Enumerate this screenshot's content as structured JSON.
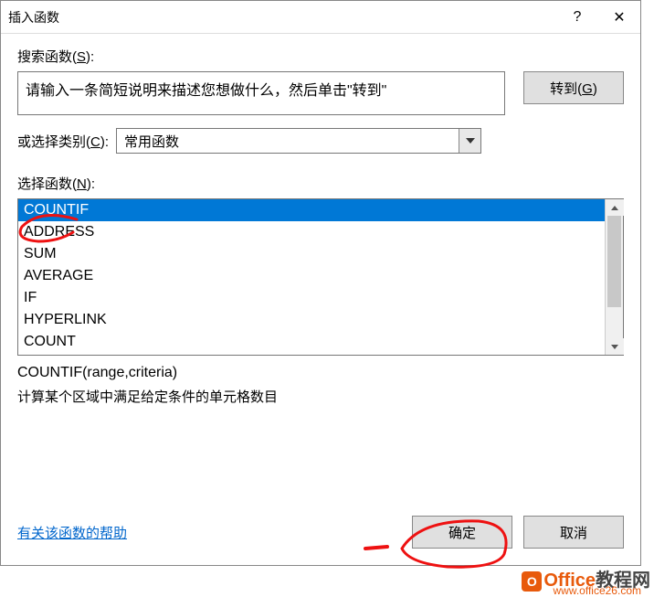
{
  "title": "插入函数",
  "help_char": "?",
  "close_char": "✕",
  "search_label_pre": "搜索函数(",
  "search_label_key": "S",
  "search_label_post": "):",
  "search_text": "请输入一条简短说明来描述您想做什么，然后单击\"转到\"",
  "go_label_pre": "转到(",
  "go_label_key": "G",
  "go_label_post": ")",
  "category_label_pre": "或选择类别(",
  "category_label_key": "C",
  "category_label_post": "):",
  "category_value": "常用函数",
  "select_label_pre": "选择函数(",
  "select_label_key": "N",
  "select_label_post": "):",
  "functions": [
    "COUNTIF",
    "ADDRESS",
    "SUM",
    "AVERAGE",
    "IF",
    "HYPERLINK",
    "COUNT"
  ],
  "selected_index": 0,
  "syntax": "COUNTIF(range,criteria)",
  "description": "计算某个区域中满足给定条件的单元格数目",
  "help_link": "有关该函数的帮助",
  "ok_label": "确定",
  "cancel_label": "取消",
  "watermark": {
    "brand": "Office",
    "suffix": "教程网",
    "url": "www.office26.com",
    "badge": "O"
  }
}
